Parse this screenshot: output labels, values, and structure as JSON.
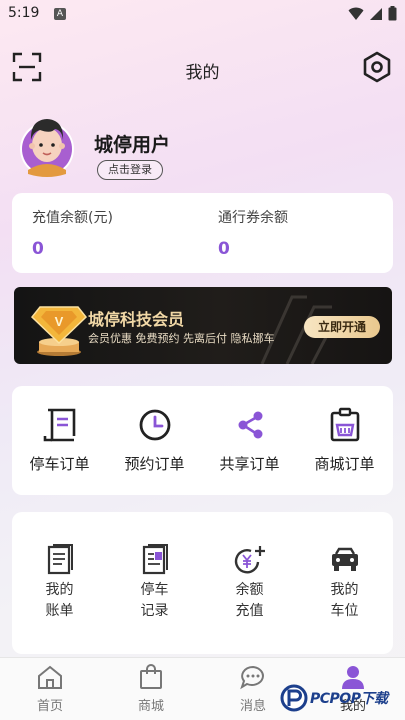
{
  "status_bar": {
    "time": "5:19",
    "notif_letter": "A"
  },
  "header": {
    "title": "我的"
  },
  "profile": {
    "username": "城停用户",
    "login_label": "点击登录"
  },
  "balance": {
    "recharge_label": "充值余额(元)",
    "recharge_value": "0",
    "voucher_label": "通行券余额",
    "voucher_value": "0"
  },
  "membership": {
    "title": "城停科技会员",
    "subtitle": "会员优惠 免费预约 先离后付 隐私挪车",
    "cta": "立即开通"
  },
  "orders": [
    {
      "icon": "scroll-document-icon",
      "label": "停车订单"
    },
    {
      "icon": "clock-icon",
      "label": "预约订单"
    },
    {
      "icon": "share-icon",
      "label": "共享订单"
    },
    {
      "icon": "shopping-basket-icon",
      "label": "商城订单"
    }
  ],
  "services": [
    {
      "icon": "bill-icon",
      "label": "我的账单"
    },
    {
      "icon": "parking-record-icon",
      "label": "停车记录"
    },
    {
      "icon": "yuan-recharge-icon",
      "label": "余额充值"
    },
    {
      "icon": "car-icon",
      "label": "我的车位"
    }
  ],
  "tabs": [
    {
      "icon": "home-icon",
      "label": "首页"
    },
    {
      "icon": "shopping-bag-icon",
      "label": "商城"
    },
    {
      "icon": "chat-bubble-icon",
      "label": "消息"
    },
    {
      "icon": "user-icon",
      "label": "我的"
    }
  ],
  "colors": {
    "accent_purple": "#8a55d6",
    "gold": "#f1d8a6",
    "banner_dark": "#1a1816"
  },
  "watermark": {
    "text": "PCPOP下载"
  }
}
